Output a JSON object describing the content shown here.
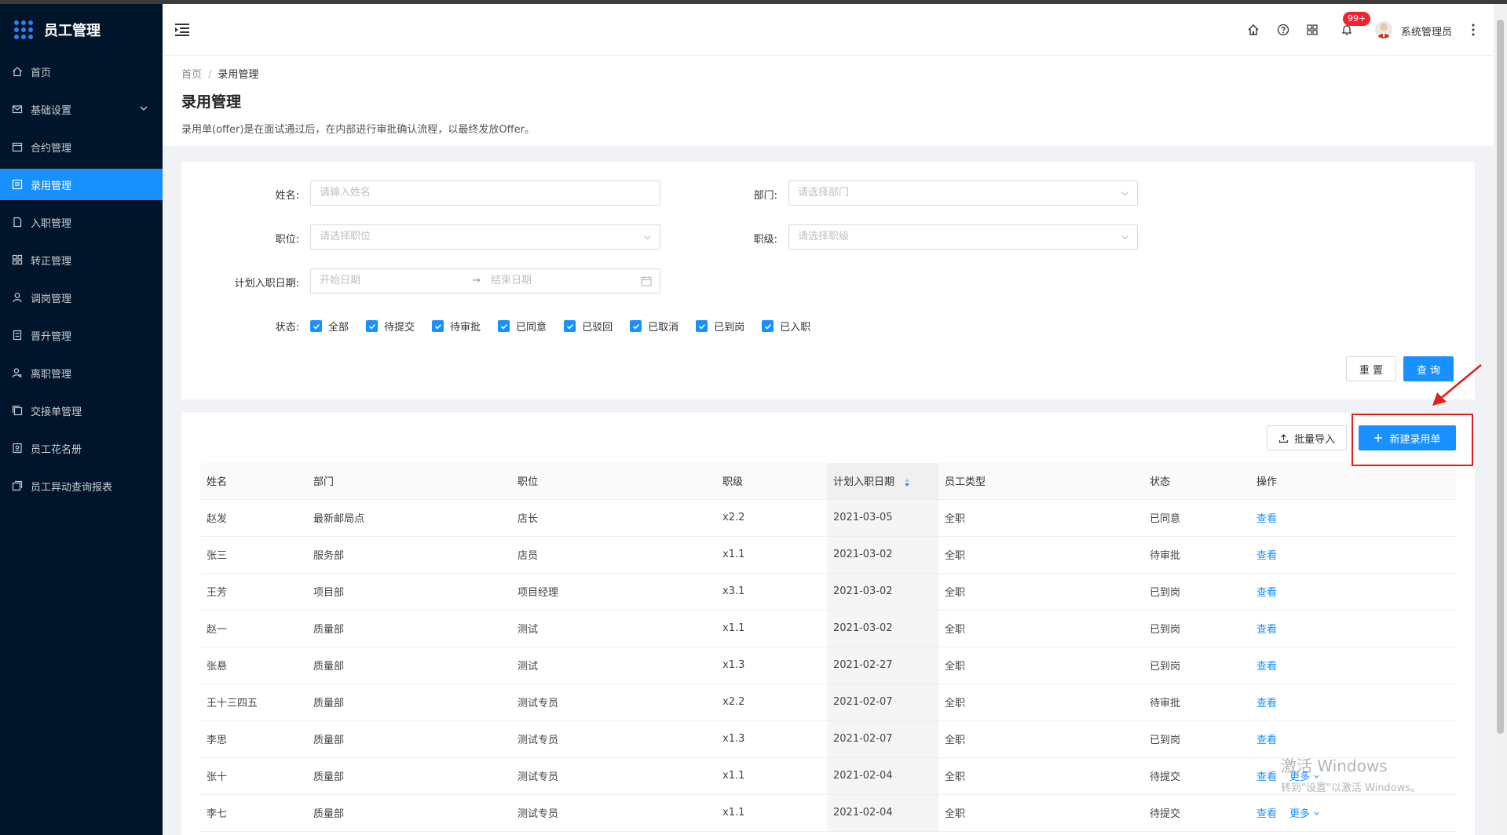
{
  "app": {
    "title": "员工管理"
  },
  "sidebar": {
    "items": [
      {
        "label": "首页",
        "icon": "home-icon"
      },
      {
        "label": "基础设置",
        "icon": "mail-icon"
      },
      {
        "label": "合约管理",
        "icon": "calendar-icon"
      },
      {
        "label": "录用管理",
        "icon": "form-icon",
        "active": true
      },
      {
        "label": "入职管理",
        "icon": "doc-icon"
      },
      {
        "label": "转正管理",
        "icon": "grid-icon"
      },
      {
        "label": "调岗管理",
        "icon": "user-icon"
      },
      {
        "label": "晋升管理",
        "icon": "file-icon"
      },
      {
        "label": "离职管理",
        "icon": "leave-icon"
      },
      {
        "label": "交接单管理",
        "icon": "copy-icon"
      },
      {
        "label": "员工花名册",
        "icon": "roster-icon"
      },
      {
        "label": "员工异动查询报表",
        "icon": "report-icon"
      }
    ]
  },
  "header": {
    "badge": "99+",
    "username": "系统管理员"
  },
  "page": {
    "breadcrumb_home": "首页",
    "breadcrumb_current": "录用管理",
    "title": "录用管理",
    "description": "录用单(offer)是在面试通过后，在内部进行审批确认流程，以最终发放Offer。"
  },
  "filter": {
    "name_label": "姓名:",
    "name_placeholder": "请输入姓名",
    "dept_label": "部门:",
    "dept_placeholder": "请选择部门",
    "position_label": "职位:",
    "position_placeholder": "请选择职位",
    "level_label": "职级:",
    "level_placeholder": "请选择职级",
    "date_label": "计划入职日期:",
    "date_start": "开始日期",
    "date_sep": "→",
    "date_end": "结束日期",
    "status_label": "状态:",
    "statuses": [
      "全部",
      "待提交",
      "待审批",
      "已同意",
      "已驳回",
      "已取消",
      "已到岗",
      "已入职"
    ],
    "reset_label": "重 置",
    "query_label": "查 询"
  },
  "toolbar": {
    "import_label": "批量导入",
    "new_label": "新建录用单"
  },
  "table": {
    "headers": [
      "姓名",
      "部门",
      "职位",
      "职级",
      "计划入职日期",
      "员工类型",
      "状态",
      "操作"
    ],
    "view_label": "查看",
    "more_label": "更多",
    "rows": [
      {
        "name": "赵发",
        "dept": "最新邮局点",
        "position": "店长",
        "level": "x2.2",
        "date": "2021-03-05",
        "type": "全职",
        "status": "已同意",
        "more": false
      },
      {
        "name": "张三",
        "dept": "服务部",
        "position": "店员",
        "level": "x1.1",
        "date": "2021-03-02",
        "type": "全职",
        "status": "待审批",
        "more": false
      },
      {
        "name": "王芳",
        "dept": "项目部",
        "position": "项目经理",
        "level": "x3.1",
        "date": "2021-03-02",
        "type": "全职",
        "status": "已到岗",
        "more": false
      },
      {
        "name": "赵一",
        "dept": "质量部",
        "position": "测试",
        "level": "x1.1",
        "date": "2021-03-02",
        "type": "全职",
        "status": "已到岗",
        "more": false
      },
      {
        "name": "张悬",
        "dept": "质量部",
        "position": "测试",
        "level": "x1.3",
        "date": "2021-02-27",
        "type": "全职",
        "status": "已到岗",
        "more": false
      },
      {
        "name": "王十三四五",
        "dept": "质量部",
        "position": "测试专员",
        "level": "x2.2",
        "date": "2021-02-07",
        "type": "全职",
        "status": "待审批",
        "more": false
      },
      {
        "name": "李思",
        "dept": "质量部",
        "position": "测试专员",
        "level": "x1.3",
        "date": "2021-02-07",
        "type": "全职",
        "status": "已到岗",
        "more": false
      },
      {
        "name": "张十",
        "dept": "质量部",
        "position": "测试专员",
        "level": "x1.1",
        "date": "2021-02-04",
        "type": "全职",
        "status": "待提交",
        "more": true
      },
      {
        "name": "李七",
        "dept": "质量部",
        "position": "测试专员",
        "level": "x1.1",
        "date": "2021-02-04",
        "type": "全职",
        "status": "待提交",
        "more": true
      }
    ]
  },
  "watermark": {
    "line1": "激活 Windows",
    "line2": "转到\"设置\"以激活 Windows。"
  },
  "colors": {
    "sidebar_bg": "#001529",
    "primary": "#1890ff",
    "highlight": "#e02020"
  }
}
